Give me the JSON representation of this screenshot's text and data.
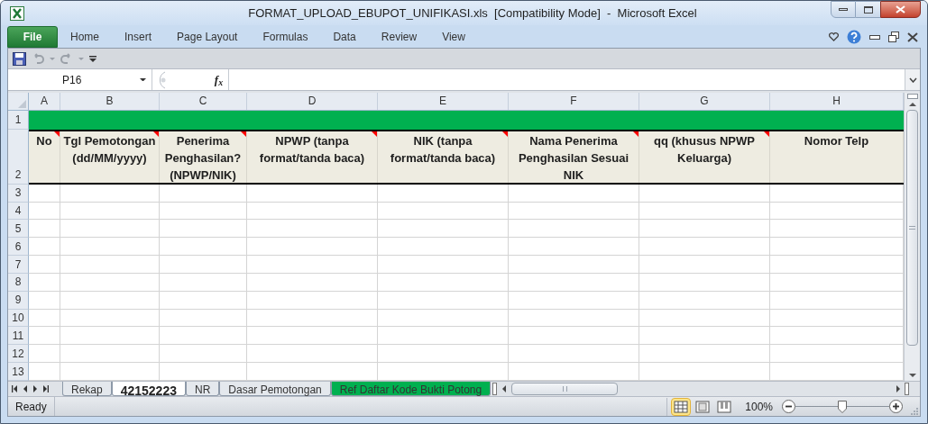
{
  "window": {
    "title": "FORMAT_UPLOAD_EBUPOT_UNIFIKASI.xls  [Compatibility Mode]  -  Microsoft Excel"
  },
  "ribbon_tabs": [
    {
      "label": "File",
      "kind": "file"
    },
    {
      "label": "Home",
      "kind": "tab"
    },
    {
      "label": "Insert",
      "kind": "tab"
    },
    {
      "label": "Page Layout",
      "kind": "tab"
    },
    {
      "label": "Formulas",
      "kind": "tab"
    },
    {
      "label": "Data",
      "kind": "tab"
    },
    {
      "label": "Review",
      "kind": "tab"
    },
    {
      "label": "View",
      "kind": "tab"
    }
  ],
  "name_box": {
    "value": "P16"
  },
  "formula_bar": {
    "function_label": "f$_{x}$"
  },
  "sheet": {
    "columns": [
      "A",
      "B",
      "C",
      "D",
      "E",
      "F",
      "G",
      "H"
    ],
    "rows": [
      {
        "number": "1",
        "kind": "band"
      },
      {
        "number": "2",
        "kind": "header",
        "cells": [
          {
            "text": "No",
            "comment": true
          },
          {
            "text": "Tgl Pemotongan (dd/MM/yyyy)",
            "comment": true
          },
          {
            "text": "Penerima Penghasilan? (NPWP/NIK)",
            "comment": true
          },
          {
            "text": "NPWP (tanpa format/tanda baca)",
            "comment": true
          },
          {
            "text": "NIK (tanpa format/tanda baca)",
            "comment": true
          },
          {
            "text": "Nama Penerima Penghasilan Sesuai NIK",
            "comment": true
          },
          {
            "text": "qq (khusus NPWP Keluarga)",
            "comment": true
          },
          {
            "text": "Nomor Telp",
            "comment": false
          }
        ]
      },
      {
        "number": "3",
        "kind": "empty"
      },
      {
        "number": "4",
        "kind": "empty"
      },
      {
        "number": "5",
        "kind": "empty"
      },
      {
        "number": "6",
        "kind": "empty"
      },
      {
        "number": "7",
        "kind": "empty"
      },
      {
        "number": "8",
        "kind": "empty"
      },
      {
        "number": "9",
        "kind": "empty"
      },
      {
        "number": "10",
        "kind": "empty"
      },
      {
        "number": "11",
        "kind": "empty"
      },
      {
        "number": "12",
        "kind": "empty"
      },
      {
        "number": "13",
        "kind": "empty"
      }
    ]
  },
  "sheet_tabs": [
    {
      "label": "Rekap",
      "selected": false
    },
    {
      "label": "42152223",
      "selected": true
    },
    {
      "label": "NR",
      "selected": false
    },
    {
      "label": "Dasar Pemotongan",
      "selected": false
    },
    {
      "label": "Ref Daftar Kode Bukti Potong",
      "selected": false,
      "color": "#00b050"
    }
  ],
  "status_bar": {
    "text": "Ready",
    "views": [
      {
        "kind": "normal",
        "selected": true
      },
      {
        "kind": "page-layout",
        "selected": false
      },
      {
        "kind": "page-break",
        "selected": false
      }
    ],
    "zoom": "100%",
    "zoom_slider": {
      "level": 0.5
    }
  }
}
